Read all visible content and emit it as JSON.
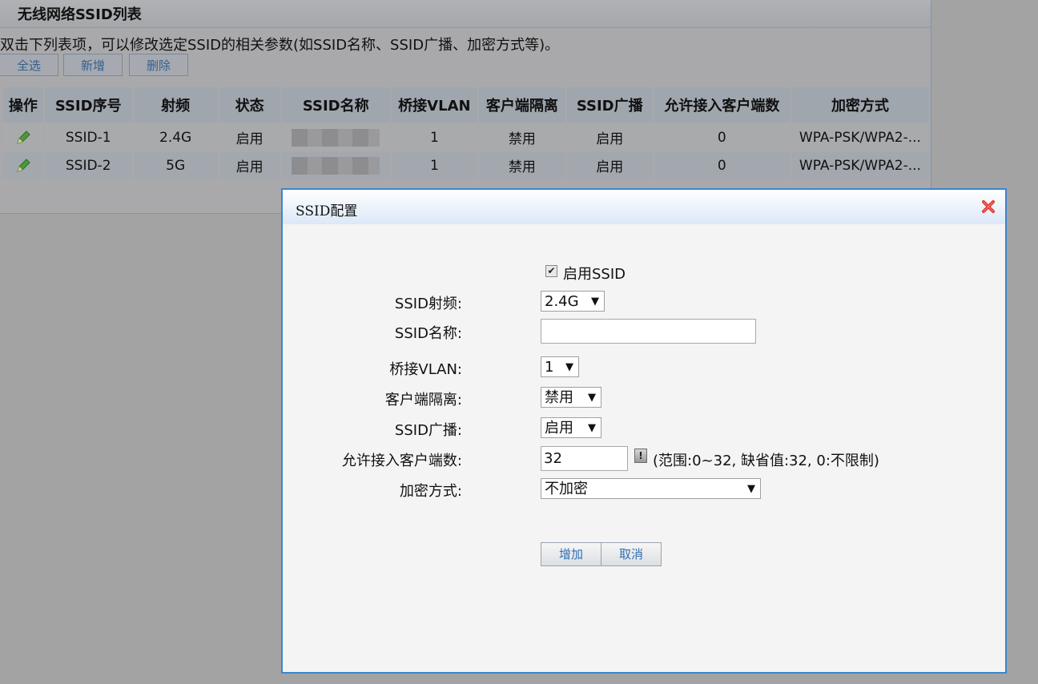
{
  "panel": {
    "title": "无线网络SSID列表",
    "hint": "双击下列表项，可以修改选定SSID的相关参数(如SSID名称、SSID广播、加密方式等)。",
    "buttons": {
      "select_all": "全选",
      "add": "新增",
      "delete": "删除"
    }
  },
  "table": {
    "headers": [
      "操作",
      "SSID序号",
      "射频",
      "状态",
      "SSID名称",
      "桥接VLAN",
      "客户端隔离",
      "SSID广播",
      "允许接入客户端数",
      "加密方式"
    ],
    "rows": [
      {
        "ssid": "SSID-1",
        "band": "2.4G",
        "status": "启用",
        "vlan": "1",
        "isolation": "禁用",
        "broadcast": "启用",
        "clients": "0",
        "encryption": "WPA-PSK/WPA2-..."
      },
      {
        "ssid": "SSID-2",
        "band": "5G",
        "status": "启用",
        "vlan": "1",
        "isolation": "禁用",
        "broadcast": "启用",
        "clients": "0",
        "encryption": "WPA-PSK/WPA2-..."
      }
    ]
  },
  "dialog": {
    "title": "SSID配置",
    "enable_label": "启用SSID",
    "enable_checked": true,
    "fields": {
      "band_label": "SSID射频:",
      "band_value": "2.4G",
      "name_label": "SSID名称:",
      "name_value": "",
      "vlan_label": "桥接VLAN:",
      "vlan_value": "1",
      "isolation_label": "客户端隔离:",
      "isolation_value": "禁用",
      "broadcast_label": "SSID广播:",
      "broadcast_value": "启用",
      "clients_label": "允许接入客户端数:",
      "clients_value": "32",
      "clients_hint": "(范围:0~32, 缺省值:32, 0:不限制)",
      "encryption_label": "加密方式:",
      "encryption_value": "不加密"
    },
    "buttons": {
      "add": "增加",
      "cancel": "取消"
    }
  },
  "colors": {
    "dialog_border": "#3c85d0",
    "close_icon": "#e0302a",
    "pencil_icon": "#3f8f2f",
    "button_text": "#2f6fb2"
  },
  "icons": [
    "edit-pencil-icon",
    "close-icon",
    "info-icon",
    "checkbox",
    "dropdown-arrow-icon"
  ]
}
